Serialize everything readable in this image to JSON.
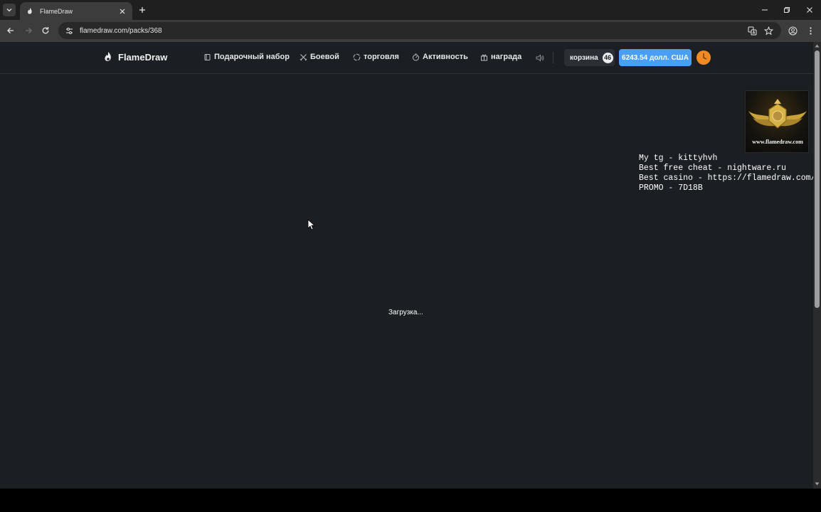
{
  "browser": {
    "tab_title": "FlameDraw",
    "url": "flamedraw.com/packs/368"
  },
  "header": {
    "logo": "FlameDraw",
    "nav": [
      {
        "label": "Подарочный набор",
        "icon": "gift-box-icon"
      },
      {
        "label": "Боевой",
        "icon": "swords-icon"
      },
      {
        "label": "торговля",
        "icon": "trade-icon"
      },
      {
        "label": "Активность",
        "icon": "activity-icon"
      },
      {
        "label": "награда",
        "icon": "reward-icon"
      }
    ],
    "cart_label": "корзина",
    "cart_count": "46",
    "balance": "6243.54 долл. США"
  },
  "overlay": {
    "image_caption": "www.flamedraw.com",
    "lines": [
      "My tg - kittyhvh",
      "Best free cheat - nightware.ru",
      "Best casino - https://flamedraw.com/",
      "PROMO - 7D18B"
    ]
  },
  "main": {
    "loading_text": "Загрузка..."
  },
  "colors": {
    "page_bg": "#1b1e22",
    "accent_blue": "#4a9ef5",
    "avatar_orange": "#f08a24"
  }
}
